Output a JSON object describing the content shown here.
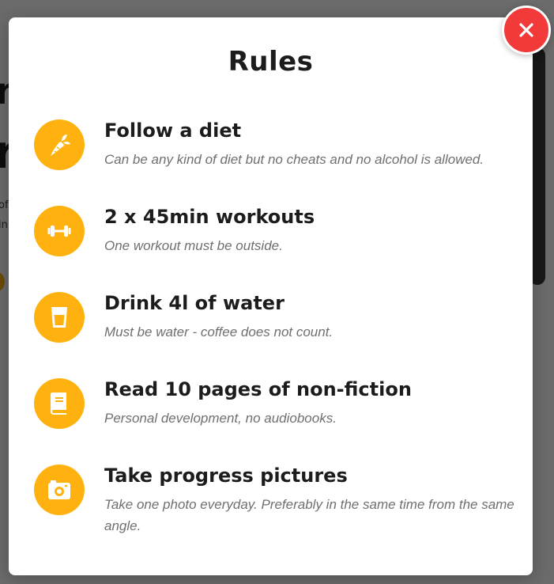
{
  "background": {
    "fragments": [
      "n",
      "r",
      "of",
      "in"
    ]
  },
  "modal": {
    "title": "Rules",
    "close_icon": "close-icon",
    "accent_color": "#ffb20f",
    "close_color": "#f23a3a",
    "rules": [
      {
        "icon": "carrot-icon",
        "title": "Follow a diet",
        "description": "Can be any kind of diet but no cheats and no alcohol is allowed."
      },
      {
        "icon": "dumbbell-icon",
        "title": "2 x 45min workouts",
        "description": "One workout must be outside."
      },
      {
        "icon": "water-glass-icon",
        "title": "Drink 4l of water",
        "description": "Must be water - coffee does not count."
      },
      {
        "icon": "book-icon",
        "title": "Read 10 pages of non-fiction",
        "description": "Personal development, no audiobooks."
      },
      {
        "icon": "camera-icon",
        "title": "Take progress pictures",
        "description": "Take one photo everyday. Preferably in the same time from the same angle."
      }
    ]
  }
}
